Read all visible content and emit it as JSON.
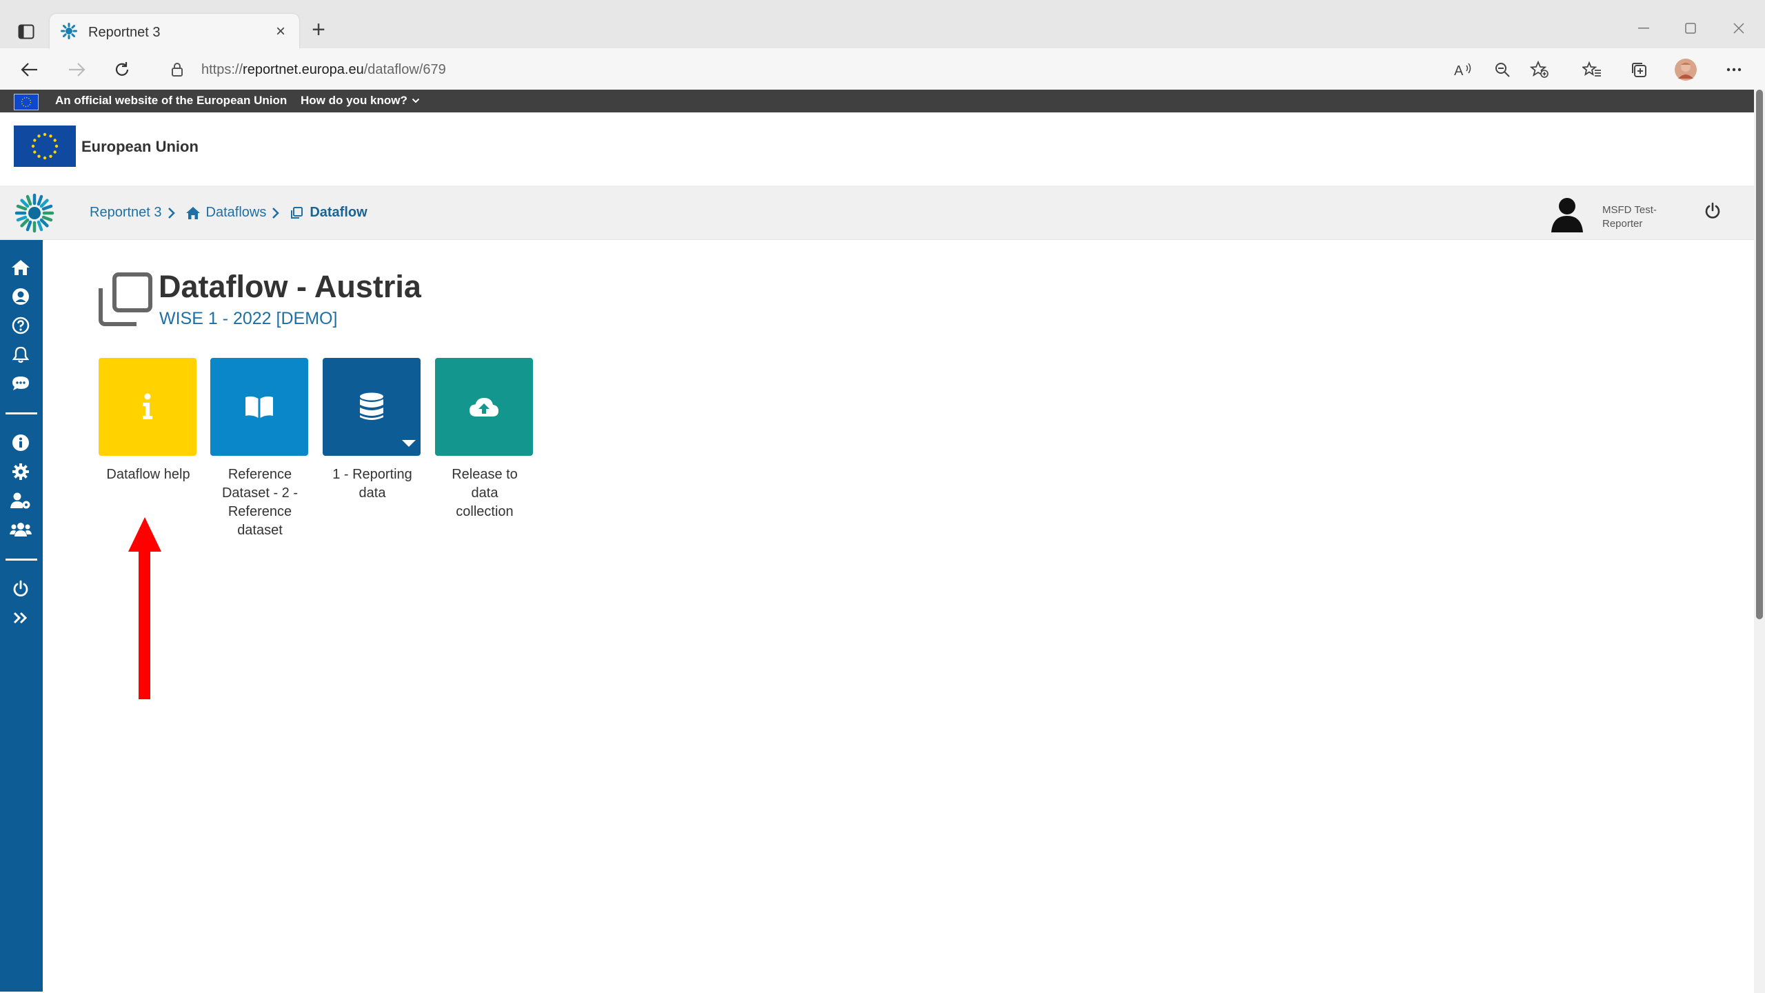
{
  "browser": {
    "tab_title": "Reportnet 3",
    "url_prefix": "https://",
    "url_host": "reportnet.europa.eu",
    "url_path": "/dataflow/679"
  },
  "eu_banner": {
    "official_text": "An official website of the European Union",
    "how_text": "How do you know?"
  },
  "eu_header": {
    "name": "European Union"
  },
  "breadcrumb": {
    "items": [
      {
        "label": "Reportnet 3"
      },
      {
        "label": "Dataflows"
      },
      {
        "label": "Dataflow"
      }
    ]
  },
  "user": {
    "name": "MSFD Test-Reporter"
  },
  "sidebar": {
    "items": [
      {
        "icon": "home-icon"
      },
      {
        "icon": "user-profile-icon"
      },
      {
        "icon": "help-icon"
      },
      {
        "icon": "notifications-bell-icon"
      },
      {
        "icon": "feedback-icon"
      },
      {
        "icon": "info-icon"
      },
      {
        "icon": "settings-gear-icon"
      },
      {
        "icon": "manage-users-icon"
      },
      {
        "icon": "users-group-icon"
      },
      {
        "icon": "logout-icon"
      },
      {
        "icon": "expand-sidebar-icon"
      }
    ]
  },
  "page": {
    "title": "Dataflow - Austria",
    "subtitle": "WISE 1 - 2022 [DEMO]"
  },
  "cards": [
    {
      "label": "Dataflow help",
      "color": "#ffd200",
      "icon": "info-icon"
    },
    {
      "label": "Reference Dataset - 2 - Reference dataset",
      "color": "#0a87c8",
      "icon": "book-icon"
    },
    {
      "label": "1 - Reporting data",
      "color": "#0d5c95",
      "icon": "database-icon"
    },
    {
      "label": "Release to data collection",
      "color": "#13968e",
      "icon": "cloud-upload-icon"
    }
  ],
  "colors": {
    "brand_blue": "#0d5c95",
    "link_blue": "#1e6fa4",
    "annotation_arrow": "#ff0000"
  }
}
